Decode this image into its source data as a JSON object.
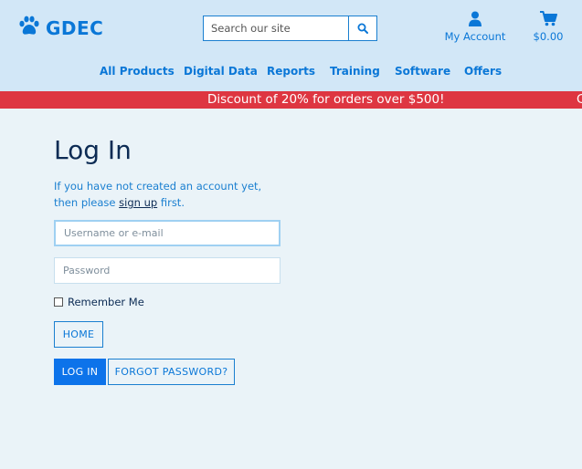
{
  "header": {
    "logo_text": "GDEC",
    "search": {
      "placeholder": "Search our site"
    },
    "account_label": "My Account",
    "cart_total": "$0.00"
  },
  "nav": {
    "items": [
      "All Products",
      "Digital Data",
      "Reports",
      "Training",
      "Software",
      "Offers"
    ]
  },
  "promo": {
    "text": "Discount of 20% for orders over $500!",
    "overflow_char": "C"
  },
  "login": {
    "title": "Log In",
    "intro_prefix": "If you have not created an account yet, then please ",
    "signup_link": "sign up",
    "intro_suffix": " first.",
    "username_placeholder": "Username or e-mail",
    "password_placeholder": "Password",
    "remember_label": "Remember Me",
    "home_button": "HOME",
    "login_button": "LOG IN",
    "forgot_button": "FORGOT PASSWORD?"
  },
  "colors": {
    "header_bg": "#d2e7f7",
    "accent": "#0a77d7",
    "promo_bg": "#de3641",
    "title": "#0c2b54",
    "page_bg": "#eaf3f8"
  },
  "icons": [
    "paw-icon",
    "search-icon",
    "user-icon",
    "cart-icon"
  ]
}
